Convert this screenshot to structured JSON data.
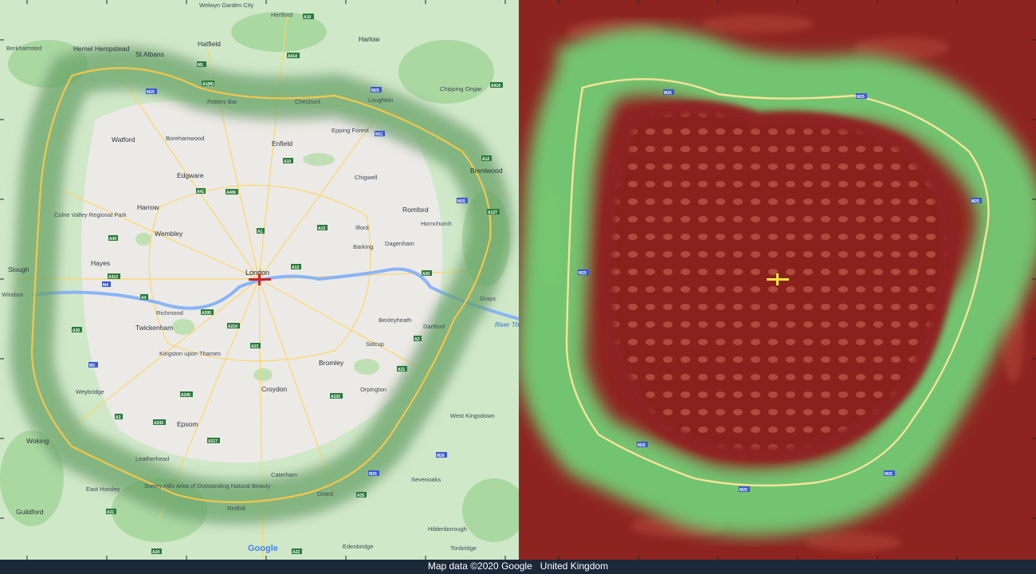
{
  "attribution": {
    "map_data": "Map data ©2020 Google",
    "region": "United Kingdom"
  },
  "google_logo": "Google",
  "river_label": "River Tha",
  "places": [
    {
      "id": "welwyn-garden-city",
      "text": "Welwyn Garden City"
    },
    {
      "id": "hertford",
      "text": "Hertford"
    },
    {
      "id": "harlow",
      "text": "Harlow"
    },
    {
      "id": "berkhamsted",
      "text": "Berkhamsted"
    },
    {
      "id": "hemel-hempstead",
      "text": "Hemel Hempstead"
    },
    {
      "id": "st-albans",
      "text": "St Albans"
    },
    {
      "id": "hatfield",
      "text": "Hatfield"
    },
    {
      "id": "chipping-ongar",
      "text": "Chipping Ongar"
    },
    {
      "id": "potters-bar",
      "text": "Potters Bar"
    },
    {
      "id": "cheshunt",
      "text": "Cheshunt"
    },
    {
      "id": "loughton",
      "text": "Loughton"
    },
    {
      "id": "epping-forest",
      "text": "Epping Forest"
    },
    {
      "id": "watford",
      "text": "Watford"
    },
    {
      "id": "borehamwood",
      "text": "Borehamwood"
    },
    {
      "id": "enfield",
      "text": "Enfield"
    },
    {
      "id": "brentwood",
      "text": "Brentwood"
    },
    {
      "id": "edgware",
      "text": "Edgware"
    },
    {
      "id": "chigwell",
      "text": "Chigwell"
    },
    {
      "id": "harrow",
      "text": "Harrow"
    },
    {
      "id": "romford",
      "text": "Romford"
    },
    {
      "id": "wembley",
      "text": "Wembley"
    },
    {
      "id": "hornchurch",
      "text": "Hornchurch"
    },
    {
      "id": "ilford",
      "text": "Ilford"
    },
    {
      "id": "dagenham",
      "text": "Dagenham"
    },
    {
      "id": "hayes",
      "text": "Hayes"
    },
    {
      "id": "barking",
      "text": "Barking"
    },
    {
      "id": "slough",
      "text": "Slough"
    },
    {
      "id": "london",
      "text": "London"
    },
    {
      "id": "windsor",
      "text": "Windsor"
    },
    {
      "id": "richmond",
      "text": "Richmond"
    },
    {
      "id": "grays",
      "text": "Grays"
    },
    {
      "id": "twickenham",
      "text": "Twickenham"
    },
    {
      "id": "bexleyheath",
      "text": "Bexleyheath"
    },
    {
      "id": "dartford",
      "text": "Dartford"
    },
    {
      "id": "sidcup",
      "text": "Sidcup"
    },
    {
      "id": "kingston",
      "text": "Kingston upon Thames"
    },
    {
      "id": "bromley",
      "text": "Bromley"
    },
    {
      "id": "croydon",
      "text": "Croydon"
    },
    {
      "id": "orpington",
      "text": "Orpington"
    },
    {
      "id": "weybridge",
      "text": "Weybridge"
    },
    {
      "id": "epsom",
      "text": "Epsom"
    },
    {
      "id": "woking",
      "text": "Woking"
    },
    {
      "id": "west-kingsdown",
      "text": "West Kingsdown"
    },
    {
      "id": "leatherhead",
      "text": "Leatherhead"
    },
    {
      "id": "caterham",
      "text": "Caterham"
    },
    {
      "id": "sevenoaks",
      "text": "Sevenoaks"
    },
    {
      "id": "east-horsley",
      "text": "East Horsley"
    },
    {
      "id": "surrey-hills",
      "text": "Surrey Hills Area of Outstanding Natural Beauty"
    },
    {
      "id": "guildford",
      "text": "Guildford"
    },
    {
      "id": "redhill",
      "text": "Redhill"
    },
    {
      "id": "oxted",
      "text": "Oxted"
    },
    {
      "id": "hildenborough",
      "text": "Hildenborough"
    },
    {
      "id": "tonbridge",
      "text": "Tonbridge"
    },
    {
      "id": "edenbridge",
      "text": "Edenbridge"
    },
    {
      "id": "colne-valley",
      "text": "Colne Valley Regional Park"
    }
  ],
  "road_shields": [
    "A1(M)",
    "M25",
    "M25",
    "M1",
    "A10",
    "A414",
    "A414",
    "M11",
    "A12",
    "M25",
    "A406",
    "A1",
    "A10",
    "A41",
    "A40",
    "A312",
    "M4",
    "A4",
    "A30",
    "A205",
    "A214",
    "A23",
    "A21",
    "A2",
    "A20",
    "A13",
    "A13",
    "A127",
    "M25",
    "M26",
    "A25",
    "A22",
    "A24",
    "A3",
    "A31",
    "A217",
    "A232",
    "A243",
    "A240",
    "M3"
  ],
  "right_panel_shields": [
    "M25",
    "M25",
    "M25",
    "M25",
    "M26",
    "M25",
    "M25"
  ],
  "colors": {
    "map_background": "#eef0ea",
    "m25_halo": "#4cae4c",
    "heatmap_background": "#8e2420",
    "heatmap_high": "#7df08a",
    "motorway": "#f7c64a",
    "thames": "#8ab4f8",
    "marker_red": "#c62828",
    "marker_yellow": "#f5e642"
  }
}
